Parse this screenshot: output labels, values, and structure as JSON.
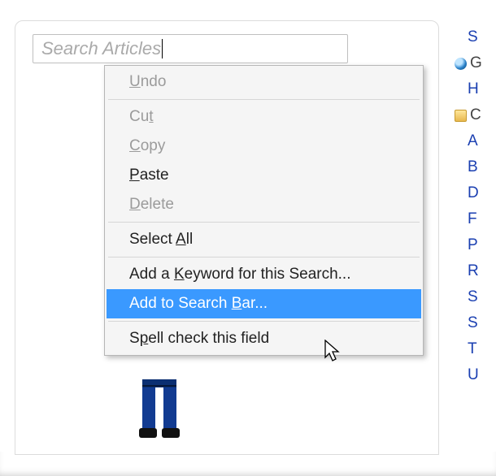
{
  "search": {
    "placeholder": "Search Articles"
  },
  "menu": {
    "undo": "ndo",
    "cut": "t",
    "copy": "opy",
    "paste": "aste",
    "delete": "elete",
    "select_all_pre": "Select ",
    "select_all_acc": "A",
    "select_all_post": "ll",
    "keyword_pre": "Add a ",
    "keyword_acc": "K",
    "keyword_post": "eyword for this Search...",
    "addbar_pre": "Add to Search ",
    "addbar_acc": "B",
    "addbar_post": "ar...",
    "spell_pre": "S",
    "spell_post": "ell check this field"
  },
  "sidebar": {
    "s": "S",
    "g": "G",
    "h": "H",
    "c": "C",
    "a": "A",
    "b": "B",
    "d": "D",
    "f": "F",
    "p": "P",
    "r": "R",
    "s2": "S",
    "s3": "S",
    "t": "T",
    "u": "U"
  }
}
